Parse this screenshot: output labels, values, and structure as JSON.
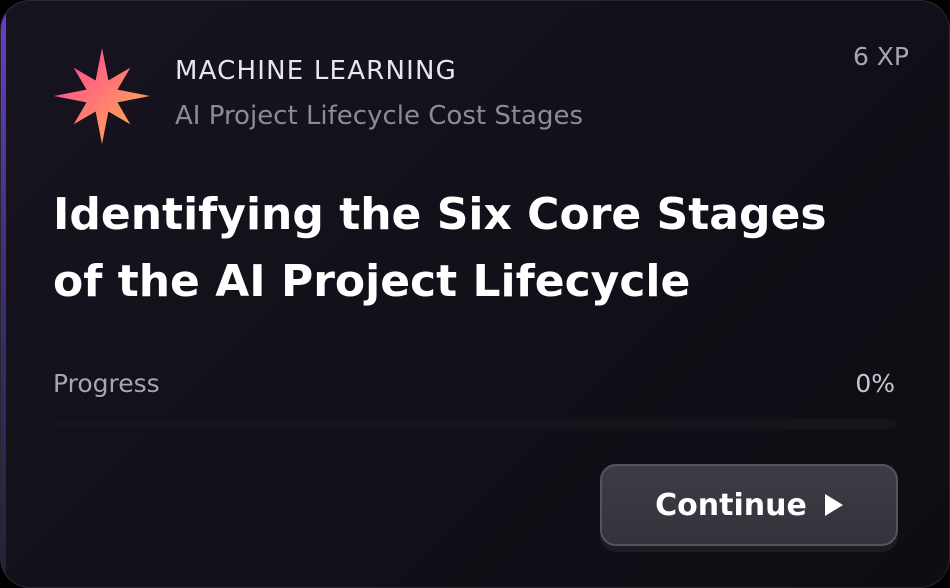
{
  "card": {
    "category": "MACHINE LEARNING",
    "subcategory": "AI Project Lifecycle Cost Stages",
    "xp": "6 XP",
    "title": "Identifying the Six Core Stages of the AI Project Lifecycle",
    "icon": "compass-star-icon",
    "accent_colors": [
      "#ff4f9a",
      "#ffb347",
      "#6a3fd1"
    ]
  },
  "progress": {
    "label": "Progress",
    "value_text": "0%",
    "value": 0
  },
  "actions": {
    "continue_label": "Continue",
    "continue_icon": "play-icon"
  }
}
